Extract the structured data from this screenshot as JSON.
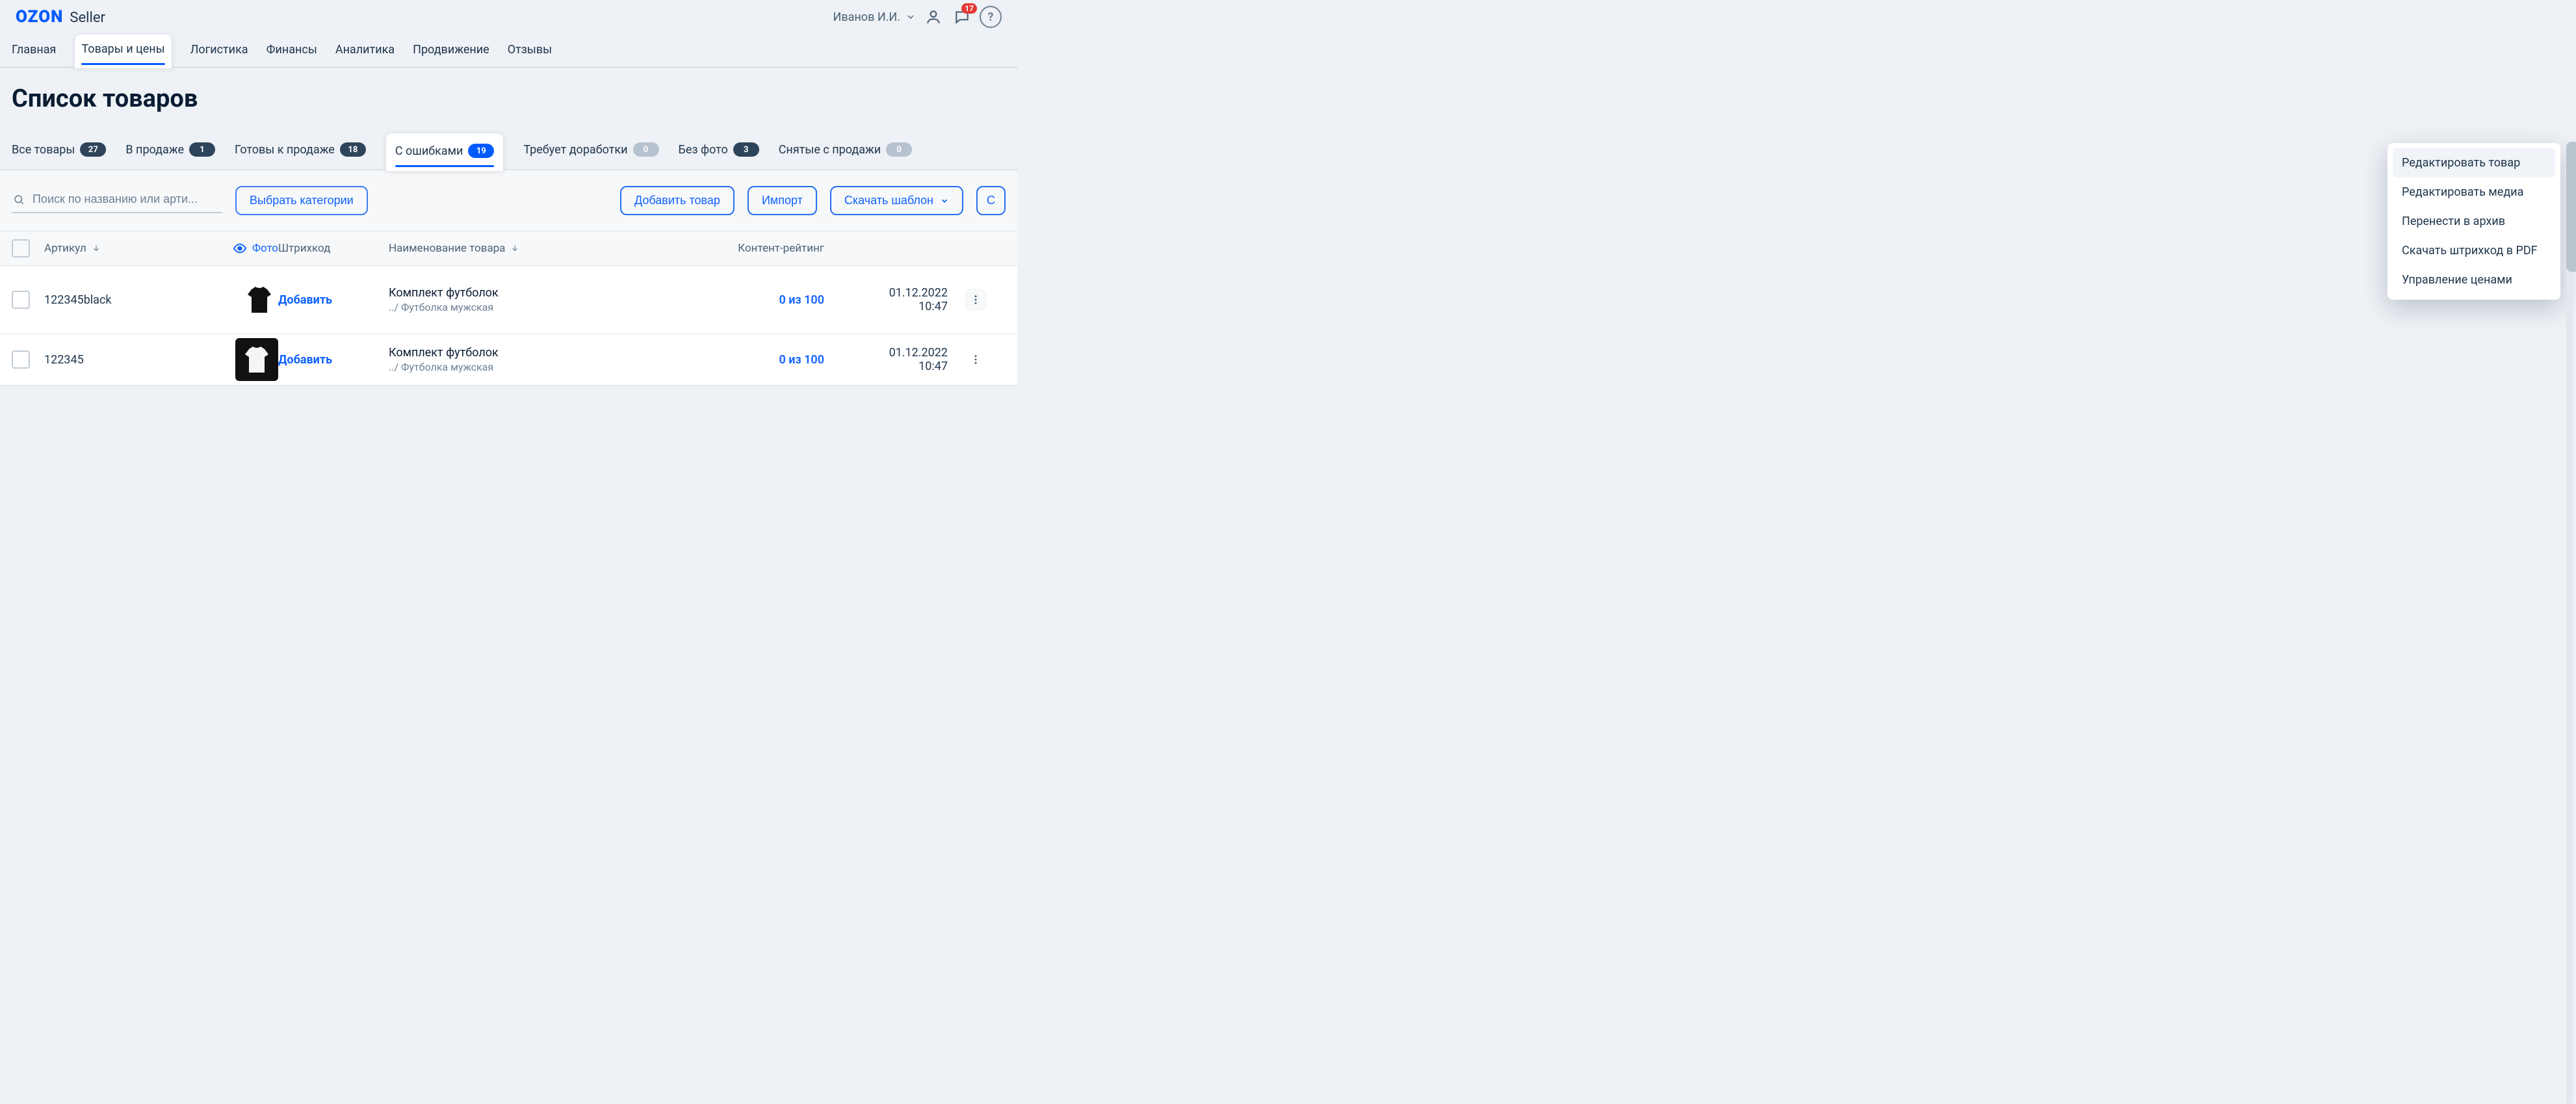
{
  "header": {
    "logo_primary": "OZON",
    "logo_secondary": "Seller",
    "username": "Иванов И.И.",
    "chat_badge": "17"
  },
  "main_nav": [
    {
      "id": "home",
      "label": "Главная",
      "active": false
    },
    {
      "id": "products",
      "label": "Товары и цены",
      "active": true
    },
    {
      "id": "logistics",
      "label": "Логистика",
      "active": false
    },
    {
      "id": "finance",
      "label": "Финансы",
      "active": false
    },
    {
      "id": "analytics",
      "label": "Аналитика",
      "active": false
    },
    {
      "id": "promo",
      "label": "Продвижение",
      "active": false
    },
    {
      "id": "reviews",
      "label": "Отзывы",
      "active": false
    }
  ],
  "page_title": "Список товаров",
  "status_tabs": [
    {
      "id": "all",
      "label": "Все товары",
      "count": "27",
      "zero": false,
      "active": false
    },
    {
      "id": "on_sale",
      "label": "В продаже",
      "count": "1",
      "zero": false,
      "active": false
    },
    {
      "id": "ready",
      "label": "Готовы к продаже",
      "count": "18",
      "zero": false,
      "active": false
    },
    {
      "id": "errors",
      "label": "С ошибками",
      "count": "19",
      "zero": false,
      "active": true
    },
    {
      "id": "needs_fix",
      "label": "Требует доработки",
      "count": "0",
      "zero": true,
      "active": false
    },
    {
      "id": "no_photo",
      "label": "Без фото",
      "count": "3",
      "zero": false,
      "active": false
    },
    {
      "id": "archived",
      "label": "Снятые с продажи",
      "count": "0",
      "zero": true,
      "active": false
    }
  ],
  "toolbar": {
    "search_placeholder": "Поиск по названию или арти...",
    "choose_categories": "Выбрать категории",
    "add_product": "Добавить товар",
    "import": "Импорт",
    "download_template": "Скачать шаблон",
    "download_extra": "С"
  },
  "columns": {
    "sku": "Артикул",
    "photo": "Фото",
    "barcode": "Штрихкод",
    "name": "Наименование товара",
    "rating": "Контент-рейтинг"
  },
  "rows": [
    {
      "sku": "122345black",
      "thumb": "black",
      "barcode_action": "Добавить",
      "name": "Комплект футболок",
      "sub": "../ Футболка мужская",
      "rating": "0 из 100",
      "date": "01.12.2022",
      "time": "10:47"
    },
    {
      "sku": "122345",
      "thumb": "white",
      "barcode_action": "Добавить",
      "name": "Комплект футболок",
      "sub": "../ Футболка мужская",
      "rating": "0 из 100",
      "date": "01.12.2022",
      "time": "10:47"
    }
  ],
  "context_menu": [
    {
      "id": "edit_product",
      "label": "Редактировать товар",
      "selected": true
    },
    {
      "id": "edit_media",
      "label": "Редактировать медиа",
      "selected": false
    },
    {
      "id": "to_archive",
      "label": "Перенести в архив",
      "selected": false
    },
    {
      "id": "barcode_pdf",
      "label": "Скачать штрихкод в PDF",
      "selected": false
    },
    {
      "id": "price_mgmt",
      "label": "Управление ценами",
      "selected": false
    }
  ],
  "colors": {
    "accent": "#005bff",
    "danger": "#e53935"
  }
}
